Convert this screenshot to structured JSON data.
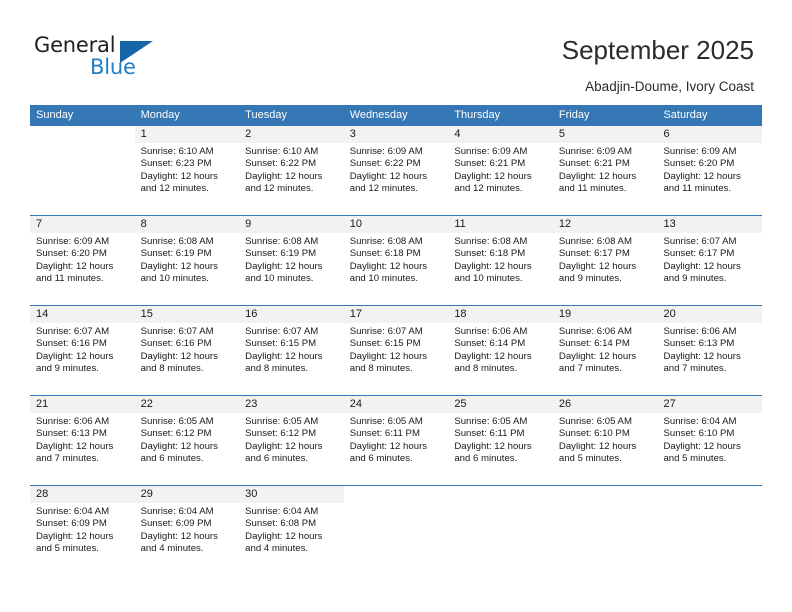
{
  "brand": {
    "name_top": "General",
    "name_bottom": "Blue",
    "accent_color": "#1f7fc4",
    "triangle_color": "#1565a8"
  },
  "header": {
    "title": "September 2025",
    "subtitle": "Abadjin-Doume, Ivory Coast"
  },
  "theme": {
    "header_blue": "#3576b5",
    "day_band_gray": "#f2f2f2"
  },
  "weekdays": [
    "Sunday",
    "Monday",
    "Tuesday",
    "Wednesday",
    "Thursday",
    "Friday",
    "Saturday"
  ],
  "weeks": [
    [
      {
        "day": "",
        "sunrise": "",
        "sunset": "",
        "daylight_line1": "",
        "daylight_line2": "",
        "blank": true
      },
      {
        "day": "1",
        "sunrise": "Sunrise: 6:10 AM",
        "sunset": "Sunset: 6:23 PM",
        "daylight_line1": "Daylight: 12 hours",
        "daylight_line2": "and 12 minutes."
      },
      {
        "day": "2",
        "sunrise": "Sunrise: 6:10 AM",
        "sunset": "Sunset: 6:22 PM",
        "daylight_line1": "Daylight: 12 hours",
        "daylight_line2": "and 12 minutes."
      },
      {
        "day": "3",
        "sunrise": "Sunrise: 6:09 AM",
        "sunset": "Sunset: 6:22 PM",
        "daylight_line1": "Daylight: 12 hours",
        "daylight_line2": "and 12 minutes."
      },
      {
        "day": "4",
        "sunrise": "Sunrise: 6:09 AM",
        "sunset": "Sunset: 6:21 PM",
        "daylight_line1": "Daylight: 12 hours",
        "daylight_line2": "and 12 minutes."
      },
      {
        "day": "5",
        "sunrise": "Sunrise: 6:09 AM",
        "sunset": "Sunset: 6:21 PM",
        "daylight_line1": "Daylight: 12 hours",
        "daylight_line2": "and 11 minutes."
      },
      {
        "day": "6",
        "sunrise": "Sunrise: 6:09 AM",
        "sunset": "Sunset: 6:20 PM",
        "daylight_line1": "Daylight: 12 hours",
        "daylight_line2": "and 11 minutes."
      }
    ],
    [
      {
        "day": "7",
        "sunrise": "Sunrise: 6:09 AM",
        "sunset": "Sunset: 6:20 PM",
        "daylight_line1": "Daylight: 12 hours",
        "daylight_line2": "and 11 minutes."
      },
      {
        "day": "8",
        "sunrise": "Sunrise: 6:08 AM",
        "sunset": "Sunset: 6:19 PM",
        "daylight_line1": "Daylight: 12 hours",
        "daylight_line2": "and 10 minutes."
      },
      {
        "day": "9",
        "sunrise": "Sunrise: 6:08 AM",
        "sunset": "Sunset: 6:19 PM",
        "daylight_line1": "Daylight: 12 hours",
        "daylight_line2": "and 10 minutes."
      },
      {
        "day": "10",
        "sunrise": "Sunrise: 6:08 AM",
        "sunset": "Sunset: 6:18 PM",
        "daylight_line1": "Daylight: 12 hours",
        "daylight_line2": "and 10 minutes."
      },
      {
        "day": "11",
        "sunrise": "Sunrise: 6:08 AM",
        "sunset": "Sunset: 6:18 PM",
        "daylight_line1": "Daylight: 12 hours",
        "daylight_line2": "and 10 minutes."
      },
      {
        "day": "12",
        "sunrise": "Sunrise: 6:08 AM",
        "sunset": "Sunset: 6:17 PM",
        "daylight_line1": "Daylight: 12 hours",
        "daylight_line2": "and 9 minutes."
      },
      {
        "day": "13",
        "sunrise": "Sunrise: 6:07 AM",
        "sunset": "Sunset: 6:17 PM",
        "daylight_line1": "Daylight: 12 hours",
        "daylight_line2": "and 9 minutes."
      }
    ],
    [
      {
        "day": "14",
        "sunrise": "Sunrise: 6:07 AM",
        "sunset": "Sunset: 6:16 PM",
        "daylight_line1": "Daylight: 12 hours",
        "daylight_line2": "and 9 minutes."
      },
      {
        "day": "15",
        "sunrise": "Sunrise: 6:07 AM",
        "sunset": "Sunset: 6:16 PM",
        "daylight_line1": "Daylight: 12 hours",
        "daylight_line2": "and 8 minutes."
      },
      {
        "day": "16",
        "sunrise": "Sunrise: 6:07 AM",
        "sunset": "Sunset: 6:15 PM",
        "daylight_line1": "Daylight: 12 hours",
        "daylight_line2": "and 8 minutes."
      },
      {
        "day": "17",
        "sunrise": "Sunrise: 6:07 AM",
        "sunset": "Sunset: 6:15 PM",
        "daylight_line1": "Daylight: 12 hours",
        "daylight_line2": "and 8 minutes."
      },
      {
        "day": "18",
        "sunrise": "Sunrise: 6:06 AM",
        "sunset": "Sunset: 6:14 PM",
        "daylight_line1": "Daylight: 12 hours",
        "daylight_line2": "and 8 minutes."
      },
      {
        "day": "19",
        "sunrise": "Sunrise: 6:06 AM",
        "sunset": "Sunset: 6:14 PM",
        "daylight_line1": "Daylight: 12 hours",
        "daylight_line2": "and 7 minutes."
      },
      {
        "day": "20",
        "sunrise": "Sunrise: 6:06 AM",
        "sunset": "Sunset: 6:13 PM",
        "daylight_line1": "Daylight: 12 hours",
        "daylight_line2": "and 7 minutes."
      }
    ],
    [
      {
        "day": "21",
        "sunrise": "Sunrise: 6:06 AM",
        "sunset": "Sunset: 6:13 PM",
        "daylight_line1": "Daylight: 12 hours",
        "daylight_line2": "and 7 minutes."
      },
      {
        "day": "22",
        "sunrise": "Sunrise: 6:05 AM",
        "sunset": "Sunset: 6:12 PM",
        "daylight_line1": "Daylight: 12 hours",
        "daylight_line2": "and 6 minutes."
      },
      {
        "day": "23",
        "sunrise": "Sunrise: 6:05 AM",
        "sunset": "Sunset: 6:12 PM",
        "daylight_line1": "Daylight: 12 hours",
        "daylight_line2": "and 6 minutes."
      },
      {
        "day": "24",
        "sunrise": "Sunrise: 6:05 AM",
        "sunset": "Sunset: 6:11 PM",
        "daylight_line1": "Daylight: 12 hours",
        "daylight_line2": "and 6 minutes."
      },
      {
        "day": "25",
        "sunrise": "Sunrise: 6:05 AM",
        "sunset": "Sunset: 6:11 PM",
        "daylight_line1": "Daylight: 12 hours",
        "daylight_line2": "and 6 minutes."
      },
      {
        "day": "26",
        "sunrise": "Sunrise: 6:05 AM",
        "sunset": "Sunset: 6:10 PM",
        "daylight_line1": "Daylight: 12 hours",
        "daylight_line2": "and 5 minutes."
      },
      {
        "day": "27",
        "sunrise": "Sunrise: 6:04 AM",
        "sunset": "Sunset: 6:10 PM",
        "daylight_line1": "Daylight: 12 hours",
        "daylight_line2": "and 5 minutes."
      }
    ],
    [
      {
        "day": "28",
        "sunrise": "Sunrise: 6:04 AM",
        "sunset": "Sunset: 6:09 PM",
        "daylight_line1": "Daylight: 12 hours",
        "daylight_line2": "and 5 minutes."
      },
      {
        "day": "29",
        "sunrise": "Sunrise: 6:04 AM",
        "sunset": "Sunset: 6:09 PM",
        "daylight_line1": "Daylight: 12 hours",
        "daylight_line2": "and 4 minutes."
      },
      {
        "day": "30",
        "sunrise": "Sunrise: 6:04 AM",
        "sunset": "Sunset: 6:08 PM",
        "daylight_line1": "Daylight: 12 hours",
        "daylight_line2": "and 4 minutes."
      },
      {
        "day": "",
        "sunrise": "",
        "sunset": "",
        "daylight_line1": "",
        "daylight_line2": "",
        "blank": true
      },
      {
        "day": "",
        "sunrise": "",
        "sunset": "",
        "daylight_line1": "",
        "daylight_line2": "",
        "blank": true
      },
      {
        "day": "",
        "sunrise": "",
        "sunset": "",
        "daylight_line1": "",
        "daylight_line2": "",
        "blank": true
      },
      {
        "day": "",
        "sunrise": "",
        "sunset": "",
        "daylight_line1": "",
        "daylight_line2": "",
        "blank": true
      }
    ]
  ]
}
